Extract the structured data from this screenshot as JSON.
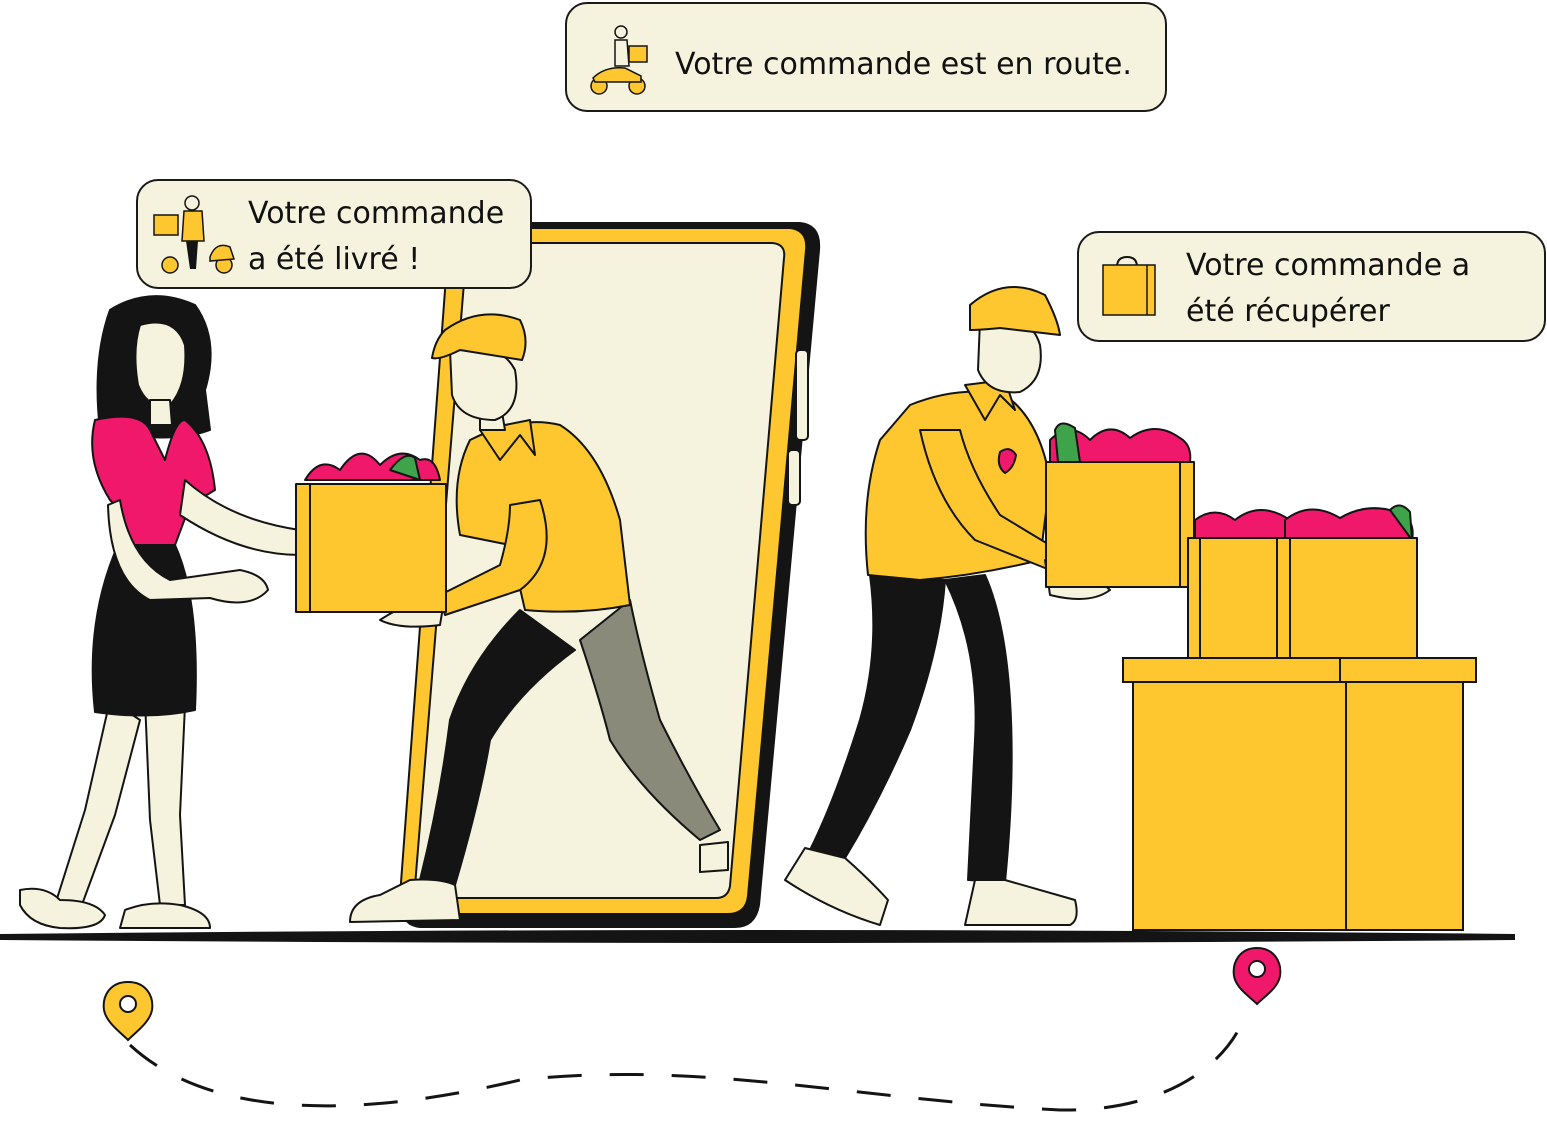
{
  "colors": {
    "yellow": "#fec730",
    "yellow_dark": "#f5b800",
    "cream": "#f5f3dd",
    "black": "#141414",
    "pink": "#f0186b",
    "grey_leg": "#8a8a7a",
    "outline": "#1a1a1a"
  },
  "bubbles": {
    "route": {
      "text": "Votre commande est en route.",
      "icon": "scooter-courier-icon"
    },
    "delivered": {
      "line1": "Votre commande",
      "line2": "a été livré !",
      "icon": "courier-with-scooter-icon"
    },
    "picked": {
      "line1": "Votre commande a",
      "line2": "été récupérer",
      "icon": "shopping-bag-icon"
    }
  },
  "pins": {
    "start": {
      "icon": "map-pin-icon",
      "color": "#fec730"
    },
    "end": {
      "icon": "map-pin-icon",
      "color": "#f0186b"
    }
  }
}
